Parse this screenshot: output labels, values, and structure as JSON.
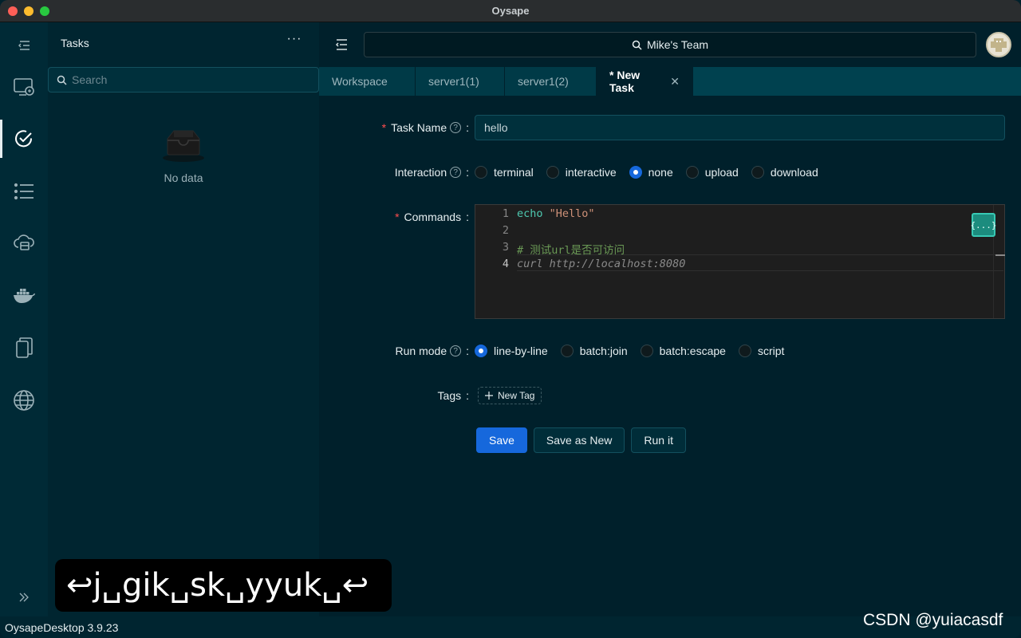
{
  "window": {
    "title": "Oysape"
  },
  "sidebar": {
    "icons": [
      "list-collapse-icon",
      "screen-icon",
      "check-circle-icon",
      "list-icon",
      "cloud-server-icon",
      "docker-icon",
      "files-icon",
      "globe-icon",
      "chevrons-right-icon"
    ]
  },
  "tasks_panel": {
    "title": "Tasks",
    "more": "···",
    "search_placeholder": "Search",
    "empty_text": "No data"
  },
  "topbar": {
    "team": "Mike's Team"
  },
  "tabs": [
    {
      "label": "Workspace"
    },
    {
      "label": "server1(1)"
    },
    {
      "label": "server1(2)"
    },
    {
      "label": "* New Task"
    }
  ],
  "form": {
    "task_name": {
      "label": "Task Name",
      "value": "hello"
    },
    "interaction": {
      "label": "Interaction",
      "options": [
        "terminal",
        "interactive",
        "none",
        "upload",
        "download"
      ],
      "selected": "none"
    },
    "commands": {
      "label": "Commands",
      "lines": [
        {
          "num": "1",
          "cmd": "echo",
          "arg": " \"Hello\""
        },
        {
          "num": "2",
          "text": ""
        },
        {
          "num": "3",
          "text": "# 测试url是否可访问"
        },
        {
          "num": "4",
          "text": "curl http://localhost:8080"
        }
      ],
      "format_button": "{...}"
    },
    "run_mode": {
      "label": "Run mode",
      "options": [
        "line-by-line",
        "batch:join",
        "batch:escape",
        "script"
      ],
      "selected": "line-by-line"
    },
    "tags": {
      "label": "Tags",
      "new_tag": "New Tag"
    },
    "buttons": {
      "save": "Save",
      "save_as_new": "Save as New",
      "run": "Run it"
    }
  },
  "status": {
    "version": "OysapeDesktop 3.9.23"
  },
  "overlay_text": "↩j␣gik␣sk␣yyuk␣↩",
  "watermark": "CSDN @yuiacasdf",
  "colors": {
    "accent": "#1668dc",
    "background": "#00202b",
    "required": "#ff4d4f"
  }
}
